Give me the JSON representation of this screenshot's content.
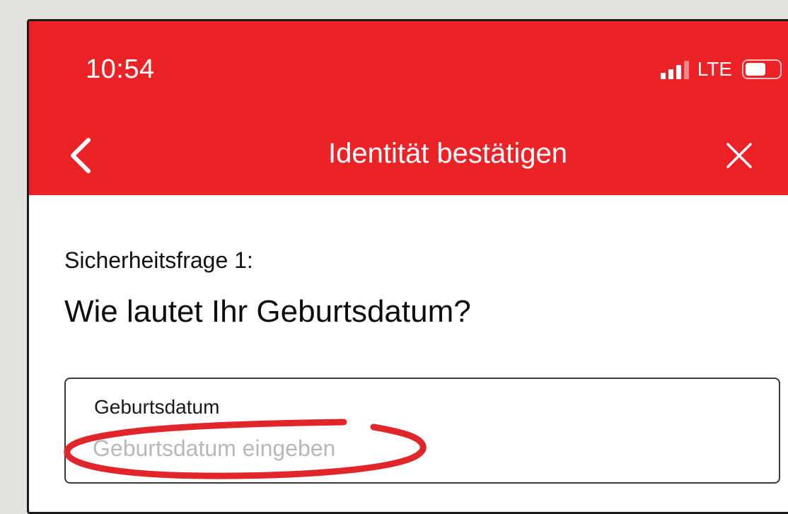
{
  "status_bar": {
    "time": "10:54",
    "network": "LTE",
    "battery_level": 0.6
  },
  "nav": {
    "title": "Identität bestätigen",
    "back_icon": "chevron-left-icon",
    "close_icon": "close-icon"
  },
  "question": {
    "label": "Sicherheitsfrage 1:",
    "text": "Wie lautet Ihr Geburtsdatum?"
  },
  "birthdate_field": {
    "label": "Geburtsdatum",
    "value": "",
    "placeholder": "Geburtsdatum eingeben"
  },
  "colors": {
    "brand_red": "#ec2227",
    "annotation_red": "#e0262b"
  }
}
